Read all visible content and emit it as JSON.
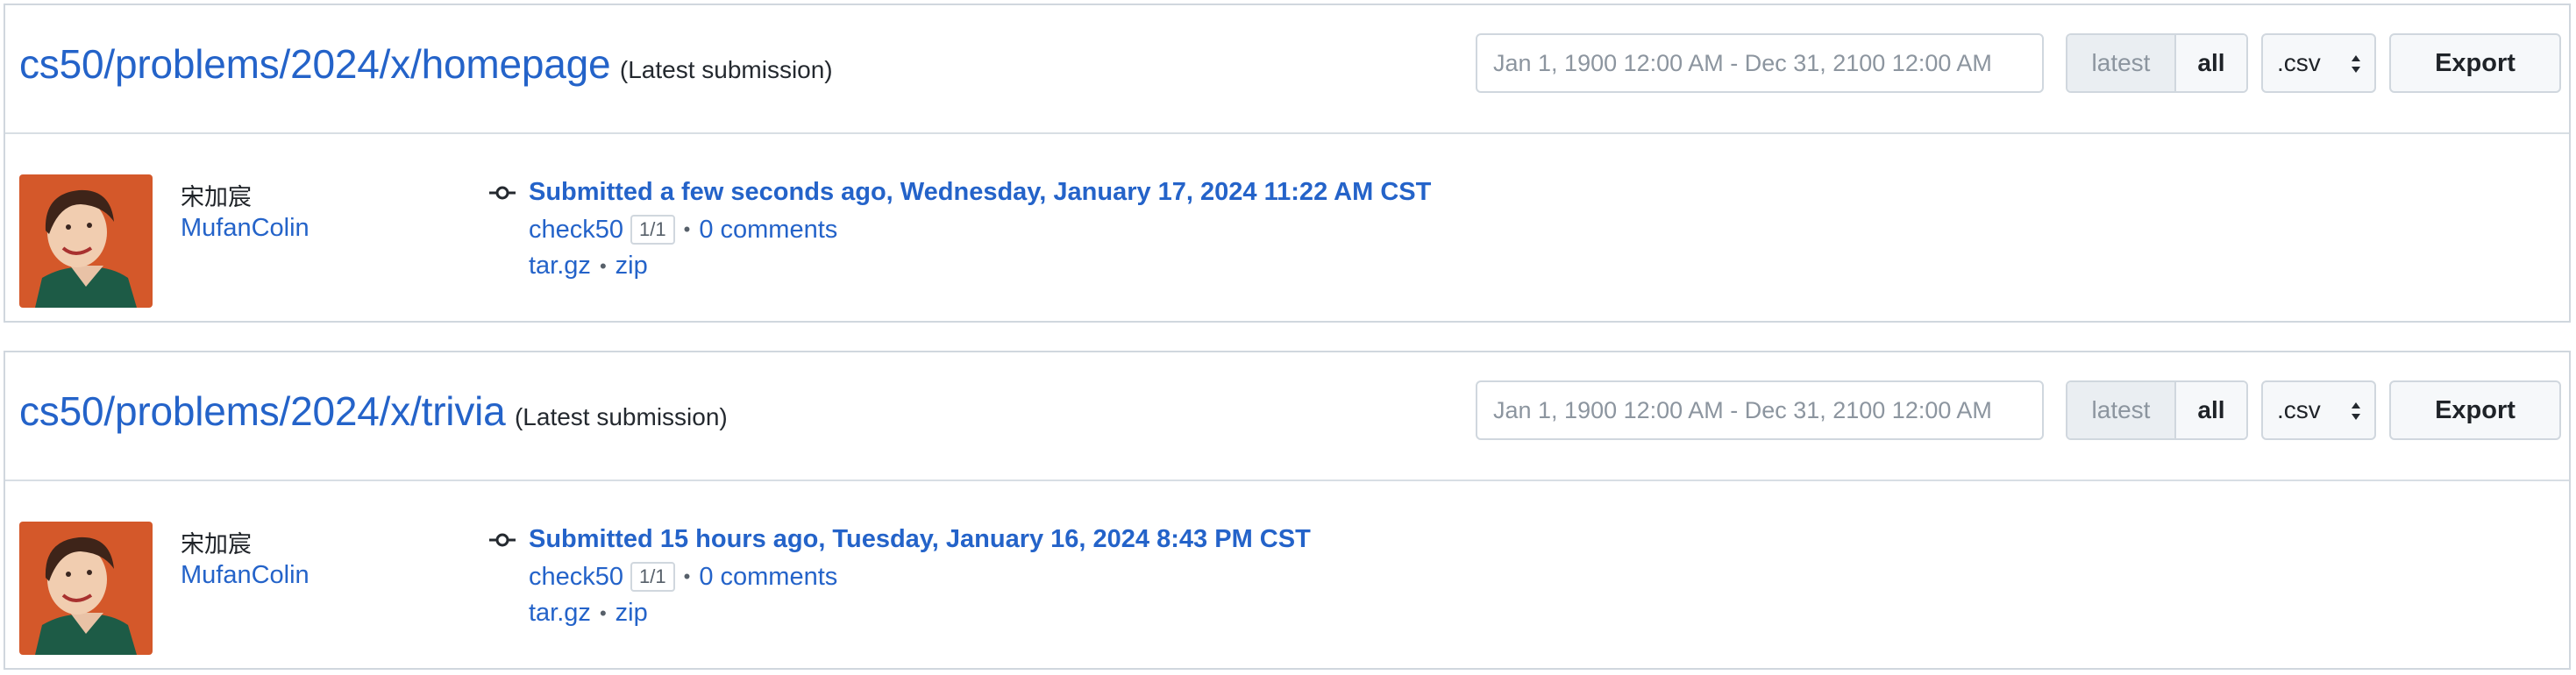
{
  "panels": [
    {
      "repo": "cs50/problems/2024/x/homepage",
      "note": "(Latest submission)",
      "date_range_placeholder": "Jan 1, 1900 12:00 AM - Dec 31, 2100 12:00 AM",
      "toggle_latest": "latest",
      "toggle_all": "all",
      "format": ".csv",
      "export_label": "Export",
      "user": {
        "display_name": "宋加宸",
        "login": "MufanColin"
      },
      "submission": {
        "submitted": "Submitted a few seconds ago, Wednesday, January 17, 2024 11:22 AM CST",
        "check": "check50",
        "score": "1/1",
        "comments": "0 comments",
        "download_targz": "tar.gz",
        "download_zip": "zip"
      }
    },
    {
      "repo": "cs50/problems/2024/x/trivia",
      "note": "(Latest submission)",
      "date_range_placeholder": "Jan 1, 1900 12:00 AM - Dec 31, 2100 12:00 AM",
      "toggle_latest": "latest",
      "toggle_all": "all",
      "format": ".csv",
      "export_label": "Export",
      "user": {
        "display_name": "宋加宸",
        "login": "MufanColin"
      },
      "submission": {
        "submitted": "Submitted 15 hours ago, Tuesday, January 16, 2024 8:43 PM CST",
        "check": "check50",
        "score": "1/1",
        "comments": "0 comments",
        "download_targz": "tar.gz",
        "download_zip": "zip"
      }
    }
  ],
  "bullet": "•",
  "colors": {
    "link": "#2463c9",
    "border": "#d0d7de",
    "button_bg": "#f6f8fa",
    "toggle_inactive_bg": "#eaeef2",
    "avatar_bg": "#d4582a"
  },
  "icons": {
    "commit": "git-commit-icon",
    "caret": "select-caret-icon",
    "avatar": "user-avatar-image"
  }
}
